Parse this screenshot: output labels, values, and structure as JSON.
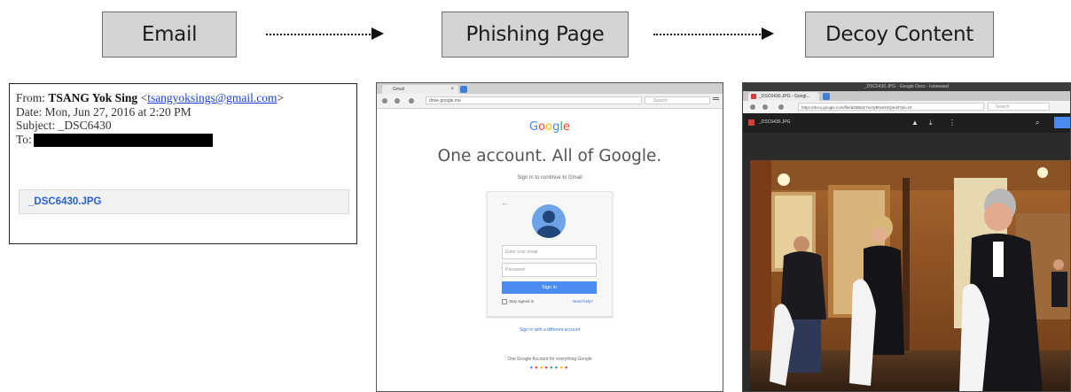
{
  "stages": {
    "email": "Email",
    "phishing": "Phishing Page",
    "decoy": "Decoy Content"
  },
  "email": {
    "from_label": "From:",
    "from_name": "TSANG Yok Sing",
    "from_email": "tsangyoksings@gmail.com",
    "date_line": "Date: Mon, Jun 27, 2016 at 2:20 PM",
    "subject_line": "Subject: _DSC6430",
    "to_label": "To:",
    "attachment": "_DSC6430.JPG"
  },
  "phishing": {
    "tab_title": "Gmail",
    "url": "drive-google.me",
    "search_placeholder": "Search",
    "logo": "Google",
    "title": "One account. All of Google.",
    "subtitle": "Sign in to continue to Gmail",
    "email_placeholder": "Enter your email",
    "password_placeholder": "Password",
    "sign_in": "Sign in",
    "stay_signed_in": "Stay signed in",
    "need_help": "Need help?",
    "different_account": "Sign in with a different account",
    "one_account": "One Google Account for everything Google"
  },
  "decoy": {
    "window_title": "_DSC6430.JPG - Google Docs - Iceweasel",
    "tab_title": "_DSC6430.JPG - Googl...",
    "url": "https://docs.google.com/file/d/0B8dz7iuYpBNoN2Q/edit?pli=1#",
    "search_placeholder": "Search",
    "file_name": "_DSC6430.JPG",
    "colors": {
      "accent": "#4a8bf0",
      "viewer_bg": "#1f1f1f"
    }
  }
}
